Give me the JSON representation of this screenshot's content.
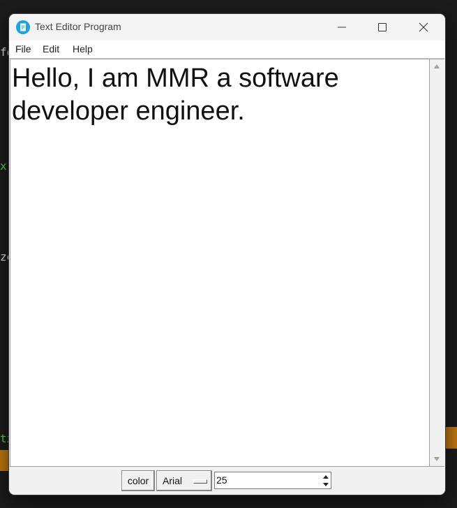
{
  "window": {
    "title": "Text Editor Program"
  },
  "menu": {
    "items": [
      "File",
      "Edit",
      "Help"
    ]
  },
  "editor": {
    "content": "Hello, I am MMR a software developer engineer."
  },
  "toolbar": {
    "color_label": "color",
    "font_family": "Arial",
    "font_size": "25"
  },
  "background": {
    "fragments": [
      "fo",
      "x",
      "ze",
      "tx"
    ]
  },
  "colors": {
    "accent": "#1fa3d8",
    "background_orange": "#b8740e",
    "background_green": "#4ec94e"
  }
}
